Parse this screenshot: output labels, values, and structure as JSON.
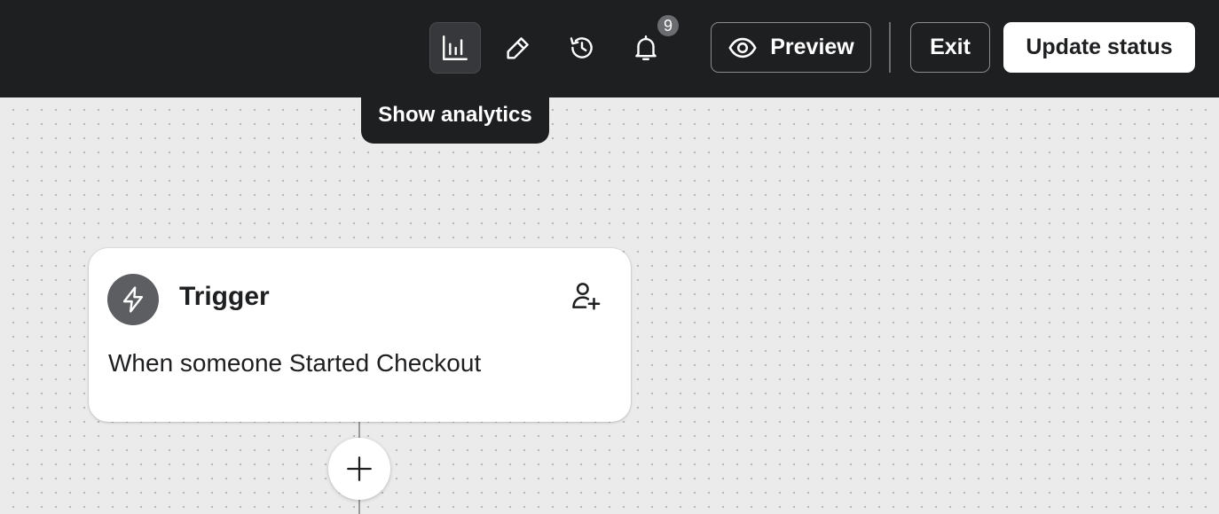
{
  "toolbar": {
    "icons": {
      "analytics": "bar-chart-icon",
      "edit": "pencil-icon",
      "history": "history-icon",
      "notifications": "bell-icon"
    },
    "notification_count": "9",
    "preview_label": "Preview",
    "exit_label": "Exit",
    "update_status_label": "Update status"
  },
  "tooltip": {
    "text": "Show analytics"
  },
  "canvas": {
    "trigger_card": {
      "title": "Trigger",
      "description": "When someone Started Checkout",
      "icon": "lightning-icon",
      "action_icon": "add-person-icon"
    },
    "add_step_icon": "plus-icon"
  },
  "colors": {
    "topbar_bg": "#1e1f21",
    "canvas_bg": "#ebebeb",
    "card_bg": "#ffffff",
    "trigger_icon_bg": "#5d5e61"
  }
}
